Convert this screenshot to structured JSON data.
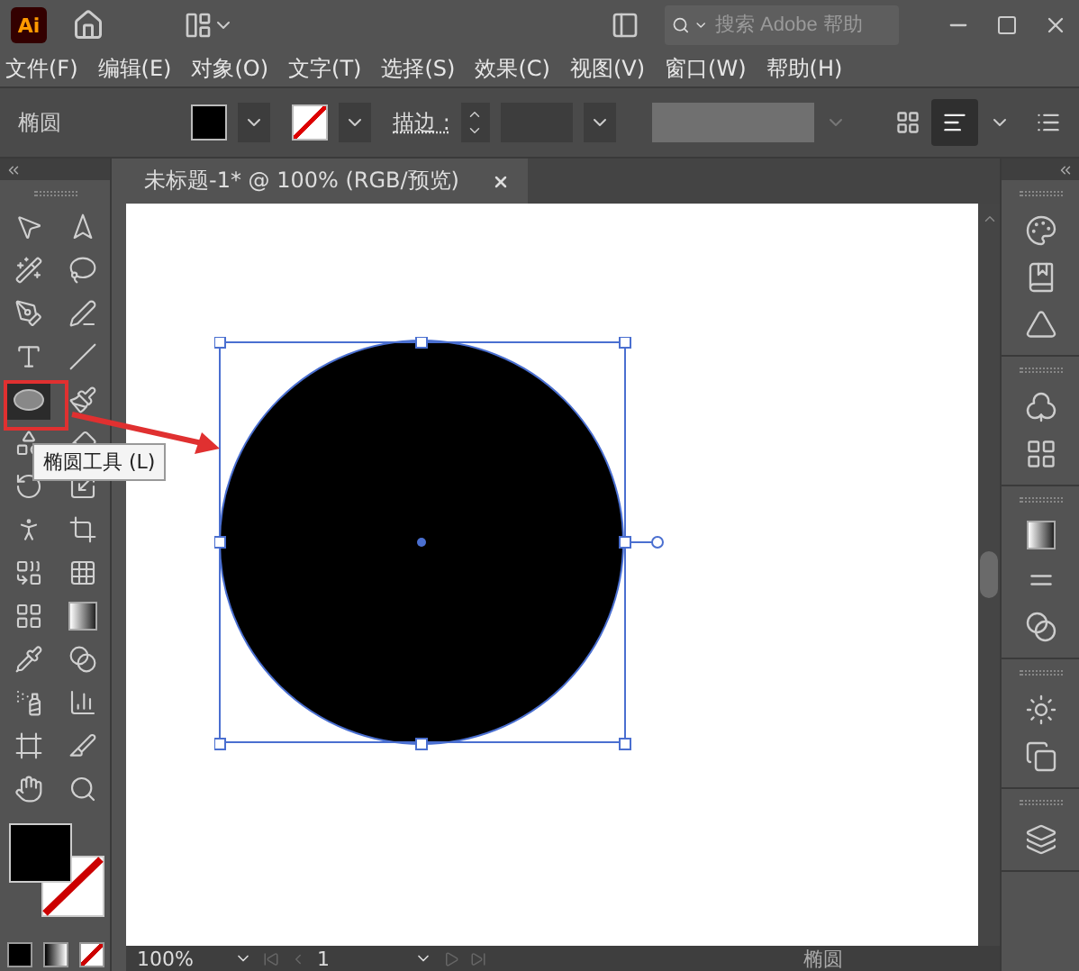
{
  "app": {
    "logo": "Ai"
  },
  "search": {
    "placeholder": "搜索 Adobe 帮助"
  },
  "menu": [
    "文件(F)",
    "编辑(E)",
    "对象(O)",
    "文字(T)",
    "选择(S)",
    "效果(C)",
    "视图(V)",
    "窗口(W)",
    "帮助(H)"
  ],
  "control_bar": {
    "object_label": "椭圆",
    "stroke_label": "描边 :"
  },
  "document_tab": {
    "title": "未标题-1* @ 100% (RGB/预览)"
  },
  "tools": [
    {
      "selected": false
    },
    {
      "selected": false
    },
    {
      "selected": false
    },
    {
      "selected": false
    },
    {
      "selected": false
    },
    {
      "selected": false
    },
    {
      "selected": false
    },
    {
      "selected": false
    },
    {
      "selected": true
    },
    {
      "selected": false
    },
    {
      "selected": false
    },
    {
      "selected": false
    },
    {
      "selected": false
    },
    {
      "selected": false
    },
    {
      "selected": false
    },
    {
      "selected": false
    },
    {
      "selected": false
    },
    {
      "selected": false
    },
    {
      "selected": false
    },
    {
      "selected": false
    },
    {
      "selected": false
    },
    {
      "selected": false
    },
    {
      "selected": false
    },
    {
      "selected": false
    },
    {
      "selected": false
    },
    {
      "selected": false
    },
    {
      "selected": false
    },
    {
      "selected": false
    }
  ],
  "tooltip": "椭圆工具 (L)",
  "status_bar": {
    "zoom": "100%",
    "artboard": "1",
    "tool": "椭圆"
  }
}
